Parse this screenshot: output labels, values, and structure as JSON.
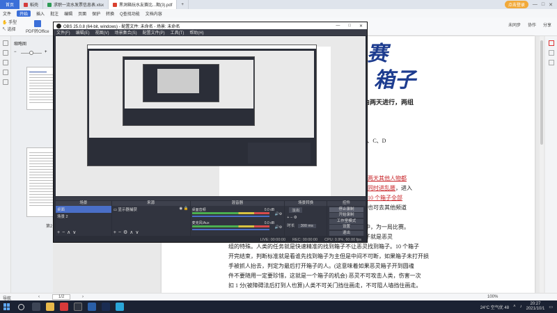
{
  "wps": {
    "tabs": {
      "home": "首页",
      "tab1": "稻壳",
      "tab2": "求职一流水发票信息表.xlsx",
      "tab3": "黑洞箱玩水友赛比...期(3).pdf",
      "new": "+"
    },
    "login": "点击登录",
    "menu": [
      "文件",
      "开始",
      "插入",
      "批注",
      "编辑",
      "页面",
      "保护",
      "转换",
      "Q查找功能",
      "文档内容"
    ],
    "menu_active": "开始",
    "toolbar": {
      "hand": "手型",
      "select": "选择",
      "pdf_office": "PDF转Office",
      "share": "未同步",
      "collab": "协作",
      "share2": "分享"
    },
    "thumb_title": "缩略图",
    "thumb_page_label": "第2",
    "page_title_1": "赛",
    "page_title_2": "箱子",
    "page_sub": "由两天进行，两组",
    "page_abcd": "B、C、D",
    "page_lines": [
      {
        "pre": "",
        "red": "两天其他人物都",
        "post": ""
      },
      {
        "pre": "",
        "red": "同时进乱腰",
        "post": "，进入"
      },
      {
        "pre": "",
        "red": "10 个箱子全部",
        "post": ""
      },
      {
        "pre": "也可去其他频道",
        "red": "",
        "post": ""
      },
      {
        "pre": "",
        "red": "",
        "post": ""
      },
      {
        "pre": "人类需要在指定的场地寻找每个鬼魂，每队共 10 个箱子中，为一局比赛。",
        "red": "",
        "post": ""
      },
      {
        "pre": "，人类的任务是在 10 个箱子中找到正确的箱子，这个箱子就是恶灵",
        "red": "",
        "post": ""
      },
      {
        "pre": "组的特殊。人类的任务就是快速精准的找到箱子不让恶灵找到箱子。10 个箱子",
        "red": "",
        "post": ""
      },
      {
        "pre": "开完结束，判断标准就是看谁先找到箱子为主但是中间不可断，如果箱子未打开损",
        "red": "",
        "post": ""
      },
      {
        "pre": "手被抓人抬去，判定为最后打开箱子的人。(这意味着如果恶灵箱子开到圆魂",
        "red": "",
        "post": ""
      },
      {
        "pre": "件不要随用一定要珍惜，这就是一个箱子的机会) 恶灵不可攻击人类，伤害一次",
        "red": "",
        "post": ""
      },
      {
        "pre": "扣 1 分(被障碍法后打到人也算)人类不可关门挡住画走，不可阻人墙挡住画走。",
        "red": "",
        "post": ""
      }
    ],
    "status": {
      "nav": "导航",
      "page": "1/2",
      "zoom": "100%"
    }
  },
  "obs": {
    "title": "OBS 25.0.8 (64-bit, windows) - 配置文件: 未命名 - 场景: 未命名",
    "menu": [
      "文件(F)",
      "编辑(E)",
      "视图(V)",
      "场景集合(S)",
      "配置文件(P)",
      "工具(T)",
      "帮助(H)"
    ],
    "docks": {
      "scenes": "场景",
      "sources": "来源",
      "mixer": "混音器",
      "transitions": "场景转换",
      "controls": "控件"
    },
    "scenes": [
      "桌面",
      "场景 2"
    ],
    "sources": [
      "显示器捕获"
    ],
    "mixer": [
      {
        "name": "桌面音频",
        "db": "0.0 dB"
      },
      {
        "name": "麦克风/Aux",
        "db": "0.0 dB"
      }
    ],
    "transition": {
      "type": "淡出",
      "duration_label": "时长",
      "duration": "300 ms"
    },
    "controls": [
      "停止录制",
      "开始录制",
      "工作室模式",
      "设置",
      "退出"
    ],
    "status": {
      "live": "LIVE: 00:00:00",
      "rec": "REC: 00:00:00",
      "cpu": "CPU: 0.9%, 60.00 fps"
    }
  },
  "taskbar": {
    "weather": "24°C 空气优 48",
    "time": "20:27",
    "date": "2021/10/1"
  }
}
